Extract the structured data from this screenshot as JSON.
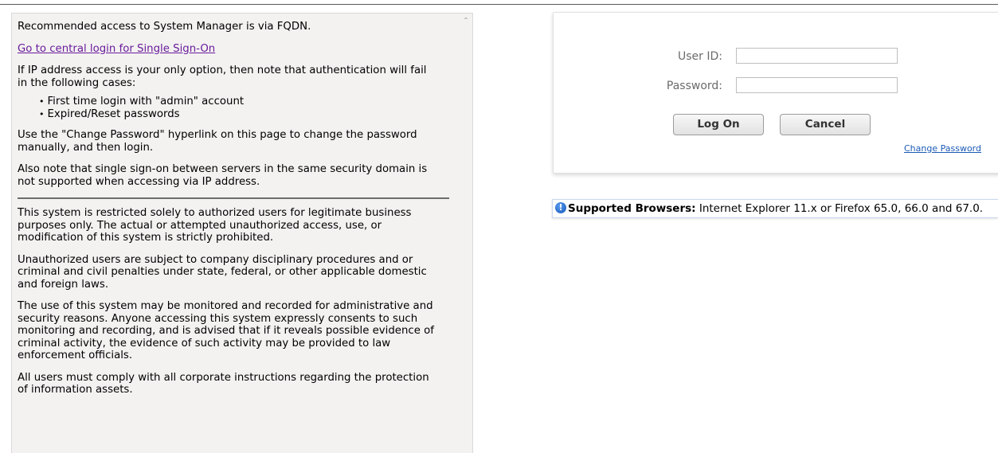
{
  "notice": {
    "recommended": "Recommended access to System Manager is via FQDN.",
    "sso_link": "Go to central login for Single Sign-On",
    "ip_warning": "If IP address access is your only option, then note that authentication will fail in the following cases:",
    "cases": [
      "First time login with \"admin\" account",
      "Expired/Reset passwords"
    ],
    "change_password_hint": "Use the \"Change Password\" hyperlink on this page to change the password manually, and then login.",
    "sso_note": "Also note that single sign-on between servers in the same security domain is not supported when accessing via IP address.",
    "legal": [
      "This system is restricted solely to authorized users for legitimate business purposes only. The actual or attempted unauthorized access, use, or modification of this system is strictly prohibited.",
      "Unauthorized users are subject to company disciplinary procedures and or criminal and civil penalties under state, federal, or other applicable domestic and foreign laws.",
      "The use of this system may be monitored and recorded for administrative and security reasons. Anyone accessing this system expressly consents to such monitoring and recording, and is advised that if it reveals possible evidence of criminal activity, the evidence of such activity may be provided to law enforcement officials.",
      "All users must comply with all corporate instructions regarding the protection of information assets."
    ]
  },
  "login": {
    "user_id_label": "User ID:",
    "user_id_value": "",
    "password_label": "Password:",
    "password_value": "",
    "logon_button": "Log On",
    "cancel_button": "Cancel",
    "change_password_link": "Change Password"
  },
  "browsers": {
    "icon": "info-icon",
    "label": "Supported Browsers:",
    "text": " Internet Explorer 11.x or Firefox 65.0, 66.0 and 67.0."
  },
  "colors": {
    "panel_bg": "#f3f2f1",
    "link_visited": "#6a1b9a",
    "link_blue": "#1c5bb5",
    "info_blue": "#1457b8"
  }
}
